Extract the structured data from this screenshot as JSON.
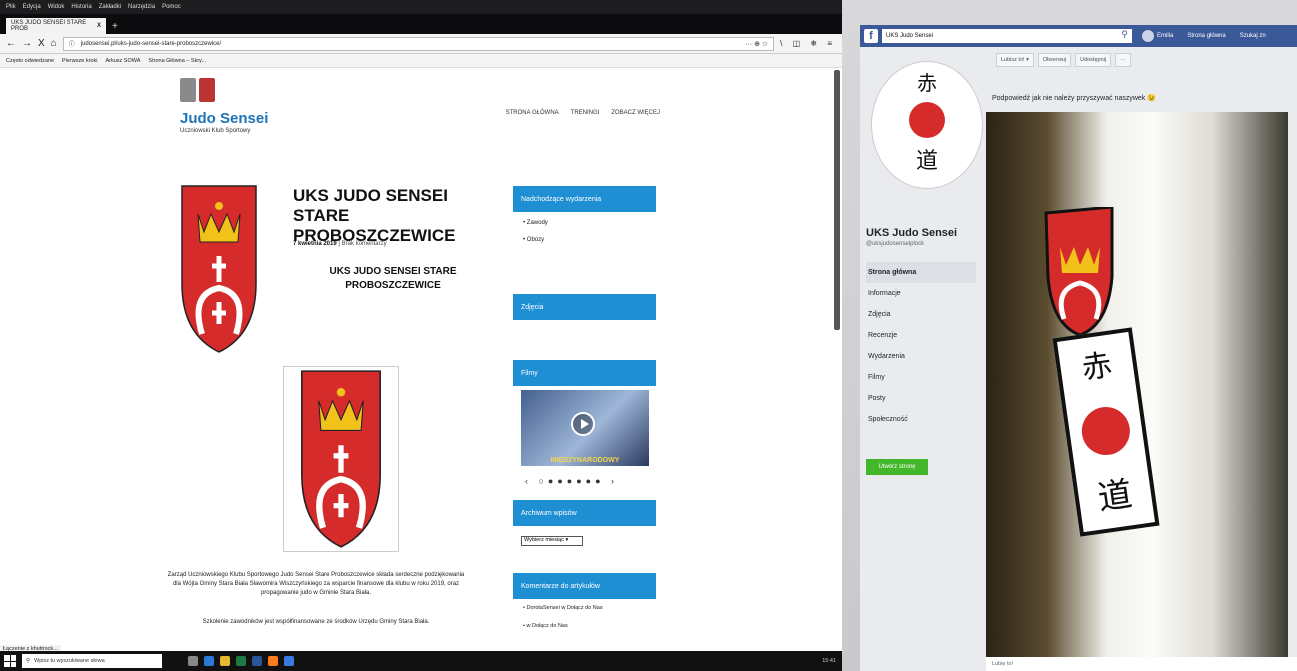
{
  "colors": {
    "site_blue": "#1d74b8",
    "widget_blue": "#1f8fd4",
    "crest_red": "#d62b2b",
    "crown_gold": "#f2c21b",
    "fb_blue": "#3b5998",
    "fb_green": "#42b72a"
  },
  "browser": {
    "menu": [
      "Plik",
      "Edycja",
      "Widok",
      "Historia",
      "Zakładki",
      "Narzędzia",
      "Pomoc"
    ],
    "tab_title": "UKS JUDO SENSEI STARE PROB",
    "tab_close": "X",
    "new_tab": "+",
    "nav_buttons": [
      "←",
      "→",
      "X",
      "⌂"
    ],
    "url": "judosensei.pl/uks-judo-sensei-stare-proboszczewice/",
    "url_actions": "··· ⊕ ☆",
    "toolbar_right": "\\ ◫ ❄ ≡",
    "bookmarks": [
      "Często odwiedzane",
      "Pierwsze kroki",
      "Arkusz SOWA",
      "Strona Główna – Skry..."
    ],
    "status": "Łączenie z khuttrock...",
    "taskbar": {
      "search_placeholder": "Wpisz tu wyszukiwane słowa",
      "clock": "15:41"
    }
  },
  "site": {
    "title": "Judo Sensei",
    "tagline": "Uczniowski Klub Sportowy",
    "nav": [
      "STRONA GŁÓWNA",
      "TRENINGI",
      "ZOBACZ WIĘCEJ"
    ],
    "post": {
      "title": "UKS JUDO SENSEI STARE PROBOSZCZEWICE",
      "date": "7 kwietnia 2019",
      "comments": "Brak komentarzy",
      "subtitle": "UKS JUDO SENSEI STARE PROBOSZCZEWICE",
      "body": "Zarząd Uczniowskiego Klubu Sportowego Judo Sensei Stare Proboszczewice składa serdeczne podziękowania dla Wójta Gminy Stara Biała Sławomira Wiszczyńskiego za wsparcie finansowe dla klubu w roku 2019, oraz propagowanie judo w Gminie Stara Biała.",
      "footnote": "Szkolenie zawodników jest współfinansowane ze środków Urzędu Gminy Stara Biała."
    },
    "sidebar": {
      "upcoming_title": "Nadchodzące wydarzenia",
      "upcoming_items": [
        "Zawody",
        "Obozy"
      ],
      "photos_title": "Zdjęcia",
      "films_title": "Filmy",
      "film_caption": "MIĘDZYNARODOWY",
      "archive_title": "Archiwum wpisów",
      "archive_select": "Wybierz miesiąc",
      "comments_title": "Komentarze do artykułów",
      "comments_items": [
        "DorotaSensei w Dołącz do Nas",
        "w Dołącz do Nas"
      ]
    }
  },
  "facebook": {
    "logo": "f",
    "search_value": "UKS Judo Sensei",
    "search_icon": "search-icon",
    "user_name": "Emilia",
    "nav_links": [
      "Strona główna",
      "Szukaj zn"
    ],
    "page_name": "UKS Judo Sensei",
    "page_handle": "@uksjudosenseiplock",
    "menu": [
      "Strona główna",
      "Informacje",
      "Zdjęcia",
      "Recenzje",
      "Wydarzenia",
      "Filmy",
      "Posty",
      "Społeczność"
    ],
    "cta": "Utwórz stronę",
    "actions": [
      "Lubisz to! ▾",
      "Obserwuj",
      "Udostępnij",
      "···"
    ],
    "post_text": "Podpowiedź jak nie należy przyszywać naszywek",
    "bottom_bar": "Lubię to!"
  }
}
